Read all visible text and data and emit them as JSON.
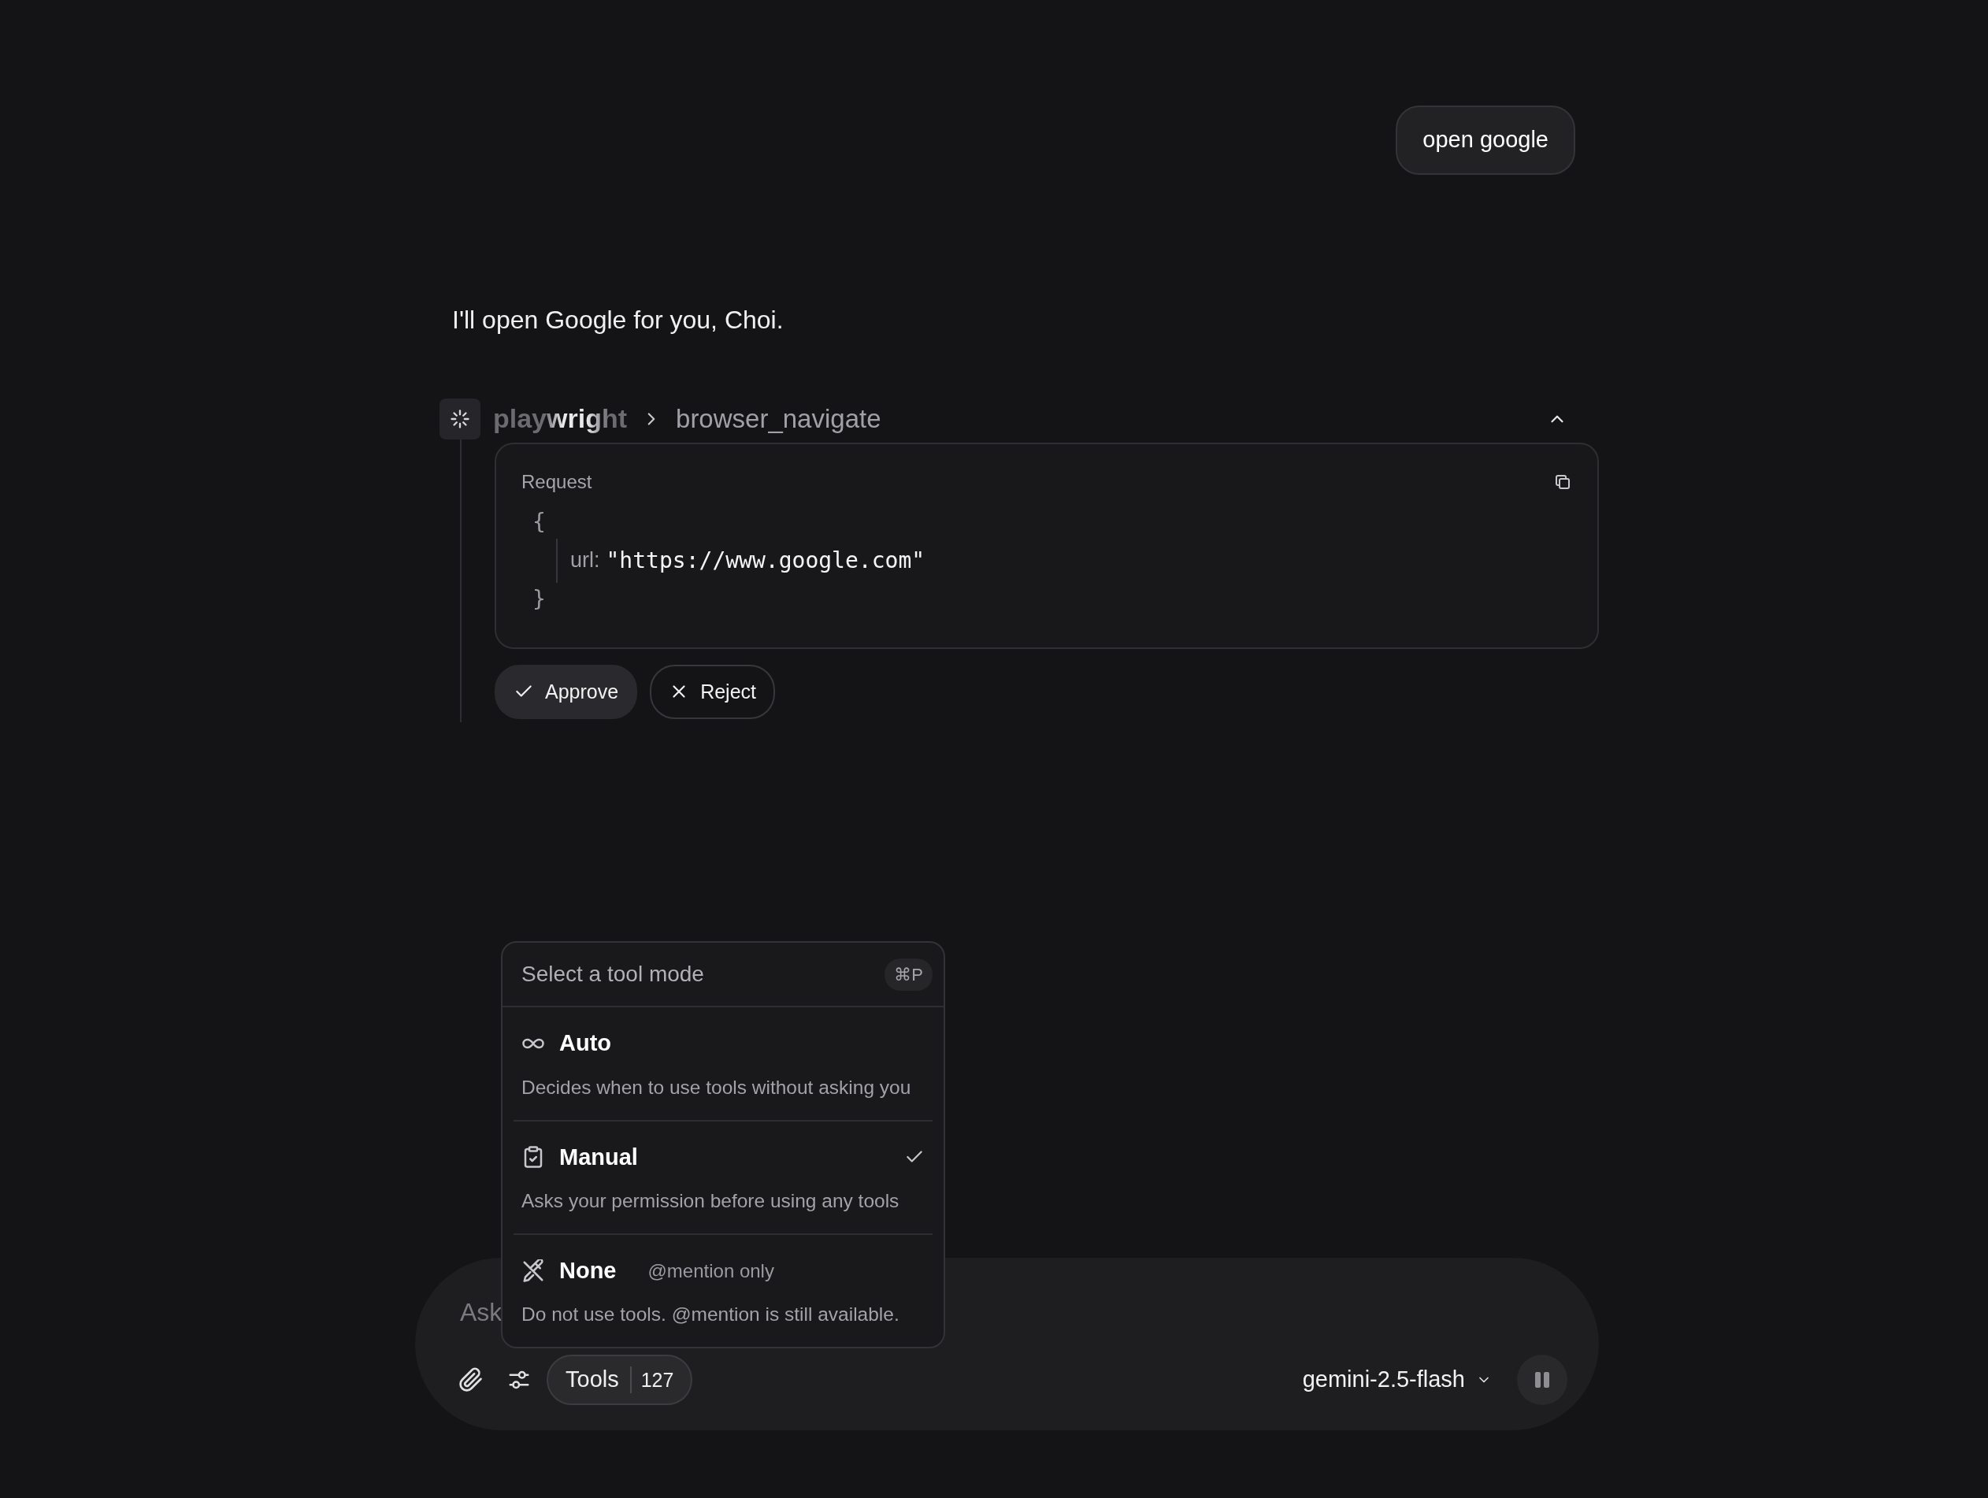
{
  "user_message": "open google",
  "assistant_message": "I'll open Google for you, Choi.",
  "tool_call": {
    "server": "playwright",
    "tool": "browser_navigate",
    "expanded": true,
    "request": {
      "label": "Request",
      "open_brace": "{",
      "key": "url:",
      "value": "\"https://www.google.com\"",
      "close_brace": "}"
    },
    "actions": [
      {
        "kind": "approve",
        "label": "Approve"
      },
      {
        "kind": "reject",
        "label": "Reject"
      }
    ]
  },
  "composer": {
    "placeholder": "Ask",
    "tools_label": "Tools",
    "tools_count": "127",
    "model": "gemini-2.5-flash"
  },
  "tool_mode_menu": {
    "title": "Select a tool mode",
    "shortcut": "⌘P",
    "options": [
      {
        "kind": "auto",
        "name": "Auto",
        "description": "Decides when to use tools without asking you",
        "selected": false
      },
      {
        "kind": "manual",
        "name": "Manual",
        "description": "Asks your permission before using any tools",
        "selected": true
      },
      {
        "kind": "none",
        "name": "None",
        "note": "@mention only",
        "description": "Do not use tools. @mention is still available.",
        "selected": false
      }
    ]
  }
}
